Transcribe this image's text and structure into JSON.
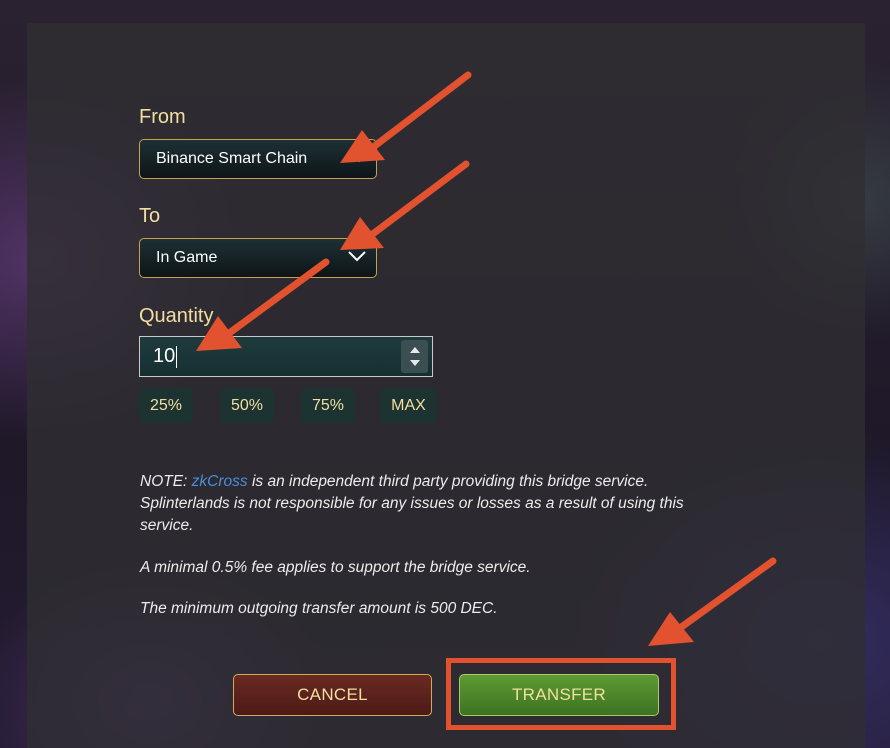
{
  "form": {
    "from": {
      "label": "From",
      "selected": "Binance Smart Chain"
    },
    "to": {
      "label": "To",
      "selected": "In Game"
    },
    "quantity": {
      "label": "Quantity",
      "value": "10"
    },
    "percent_buttons": [
      "25%",
      "50%",
      "75%",
      "MAX"
    ]
  },
  "notes": {
    "line1_prefix": "NOTE: ",
    "line1_link": "zkCross",
    "line1_rest": " is an independent third party providing this bridge service. Splinterlands is not responsible for any issues or losses as a result of using this service.",
    "fee": "A minimal 0.5% fee applies to support the bridge service.",
    "minimum": "The minimum outgoing transfer amount is 500 DEC."
  },
  "actions": {
    "cancel_label": "CANCEL",
    "transfer_label": "TRANSFER"
  },
  "icons": {
    "chevron": "chevron-down-icon",
    "spinner_up": "spin-up-icon",
    "spinner_down": "spin-down-icon",
    "arrow": "arrow-annotation-icon"
  },
  "colors": {
    "label_gold": "#f2dfa0",
    "annotation_orange": "#e2522f",
    "transfer_green": "#4f8a2c",
    "cancel_red": "#5a2019",
    "link_blue": "#4a8fd6"
  }
}
